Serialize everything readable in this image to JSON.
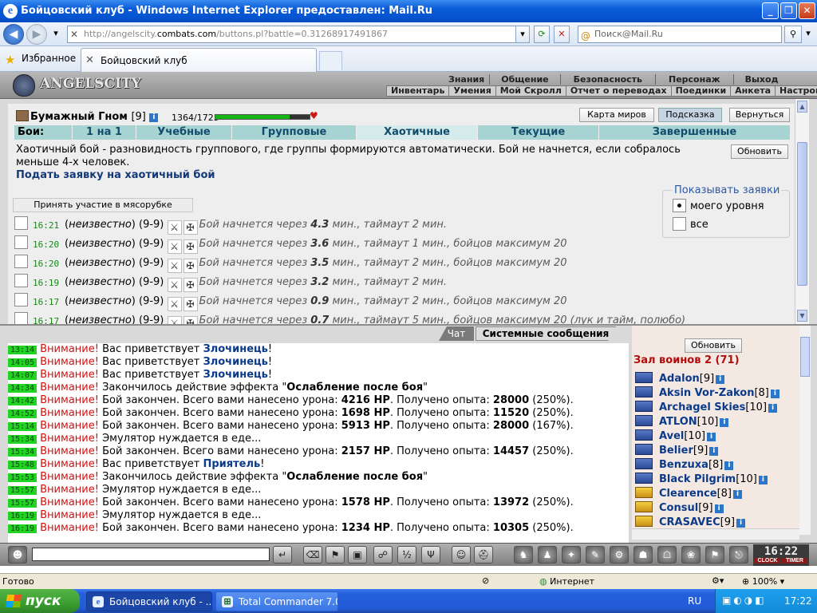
{
  "window": {
    "title": "Бойцовский клуб - Windows Internet Explorer предоставлен: Mail.Ru"
  },
  "browser": {
    "url_prefix": "http://angelscity.",
    "url_domain": "combats.com",
    "url_rest": "/buttons.pl?battle=0.31268917491867",
    "search_placeholder": "Поиск@Mail.Ru",
    "favorites_label": "Избранное",
    "tab_title": "Бойцовский клуб"
  },
  "game": {
    "logo_text": "ANGELSCITY",
    "menu_top": [
      "Знания",
      "Общение",
      "Безопасность",
      "Персонаж",
      "Выход"
    ],
    "menu_bottom": [
      "Инвентарь",
      "Умения",
      "Мой Скролл",
      "Отчет о переводах",
      "Поединки",
      "Анкета",
      "Настройки"
    ],
    "player": {
      "name": "Бумажный Гном",
      "level": "[9]",
      "hp": "1364/1725",
      "hp_fraction": 0.79
    },
    "top_buttons": [
      "Карта миров",
      "Подсказка",
      "Вернуться"
    ],
    "tabs_label": "Бои:",
    "tabs": [
      "1 на 1",
      "Учебные",
      "Групповые",
      "Хаотичные",
      "Текущие",
      "Завершенные"
    ],
    "selected_tab": "Хаотичные",
    "description": "Хаотичный бой - разновидность группового, где группы формируются автоматически. Бой не начнется, если собралось меньше 4-х человек.",
    "refresh_label": "Обновить",
    "apply_link": "Подать заявку на хаотичный бой",
    "join_button": "Принять участие в мясорубке",
    "show_filter": {
      "caption": "Показывать заявки",
      "options": [
        "моего уровня",
        "все"
      ],
      "selected": "моего уровня"
    },
    "battles": [
      {
        "time": "16:21",
        "who": "неизвестно",
        "range": "(9-9)",
        "msg_pre": "Бой начнется через ",
        "minutes": "4.3",
        "msg_post": " мин., таймаут 2 мин."
      },
      {
        "time": "16:20",
        "who": "неизвестно",
        "range": "(9-9)",
        "msg_pre": "Бой начнется через ",
        "minutes": "3.6",
        "msg_post": " мин., таймаут 1 мин., бойцов максимум 20"
      },
      {
        "time": "16:20",
        "who": "неизвестно",
        "range": "(9-9)",
        "msg_pre": "Бой начнется через ",
        "minutes": "3.5",
        "msg_post": " мин., таймаут 2 мин., бойцов максимум 20"
      },
      {
        "time": "16:19",
        "who": "неизвестно",
        "range": "(9-9)",
        "msg_pre": "Бой начнется через ",
        "minutes": "3.2",
        "msg_post": " мин., таймаут 2 мин."
      },
      {
        "time": "16:17",
        "who": "неизвестно",
        "range": "(9-9)",
        "msg_pre": "Бой начнется через ",
        "minutes": "0.9",
        "msg_post": " мин., таймаут 2 мин., бойцов максимум 20"
      },
      {
        "time": "16:17",
        "who": "неизвестно",
        "range": "(9-9)",
        "msg_pre": "Бой начнется через ",
        "minutes": "0.7",
        "msg_post": " мин., таймаут 5 мин., бойцов максимум 20 (лук и тайм, полюбо)"
      }
    ],
    "chat_tabs": [
      "Чат",
      "Системные сообщения"
    ],
    "chat": [
      {
        "ts": "13:14",
        "w": "Внимание!",
        "parts": [
          [
            "Вас приветствует ",
            ""
          ],
          [
            "Злочинець",
            "nm"
          ],
          [
            "!",
            ""
          ]
        ]
      },
      {
        "ts": "14:05",
        "w": "Внимание!",
        "parts": [
          [
            "Вас приветствует ",
            ""
          ],
          [
            "Злочинець",
            "nm"
          ],
          [
            "!",
            ""
          ]
        ]
      },
      {
        "ts": "14:07",
        "w": "Внимание!",
        "parts": [
          [
            "Вас приветствует ",
            ""
          ],
          [
            "Злочинець",
            "nm"
          ],
          [
            "!",
            ""
          ]
        ]
      },
      {
        "ts": "14:34",
        "w": "Внимание!",
        "parts": [
          [
            "Закончилось действие эффекта \"",
            ""
          ],
          [
            "Ослабление после боя",
            "b"
          ],
          [
            "\"",
            ""
          ]
        ]
      },
      {
        "ts": "14:42",
        "w": "Внимание!",
        "parts": [
          [
            "Бой закончен. Всего вами нанесено урона: ",
            ""
          ],
          [
            "4216 HP",
            "b"
          ],
          [
            ". Получено опыта: ",
            ""
          ],
          [
            "28000",
            "b"
          ],
          [
            " (250%).",
            ""
          ]
        ]
      },
      {
        "ts": "14:52",
        "w": "Внимание!",
        "parts": [
          [
            "Бой закончен. Всего вами нанесено урона: ",
            ""
          ],
          [
            "1698 HP",
            "b"
          ],
          [
            ". Получено опыта: ",
            ""
          ],
          [
            "11520",
            "b"
          ],
          [
            " (250%).",
            ""
          ]
        ]
      },
      {
        "ts": "15:14",
        "w": "Внимание!",
        "parts": [
          [
            "Бой закончен. Всего вами нанесено урона: ",
            ""
          ],
          [
            "5913 HP",
            "b"
          ],
          [
            ". Получено опыта: ",
            ""
          ],
          [
            "28000",
            "b"
          ],
          [
            " (167%).",
            ""
          ]
        ]
      },
      {
        "ts": "15:34",
        "w": "Внимание!",
        "parts": [
          [
            "Эмулятор нуждается в еде...",
            ""
          ]
        ]
      },
      {
        "ts": "15:34",
        "w": "Внимание!",
        "parts": [
          [
            "Бой закончен. Всего вами нанесено урона: ",
            ""
          ],
          [
            "2157 HP",
            "b"
          ],
          [
            ". Получено опыта: ",
            ""
          ],
          [
            "14457",
            "b"
          ],
          [
            " (250%).",
            ""
          ]
        ]
      },
      {
        "ts": "15:48",
        "w": "Внимание!",
        "parts": [
          [
            "Вас приветствует ",
            ""
          ],
          [
            "Приятель",
            "nm"
          ],
          [
            "!",
            ""
          ]
        ]
      },
      {
        "ts": "15:53",
        "w": "Внимание!",
        "parts": [
          [
            "Закончилось действие эффекта \"",
            ""
          ],
          [
            "Ослабление после боя",
            "b"
          ],
          [
            "\"",
            ""
          ]
        ]
      },
      {
        "ts": "15:57",
        "w": "Внимание!",
        "parts": [
          [
            "Эмулятор нуждается в еде...",
            ""
          ]
        ]
      },
      {
        "ts": "15:57",
        "w": "Внимание!",
        "parts": [
          [
            "Бой закончен. Всего вами нанесено урона: ",
            ""
          ],
          [
            "1578 HP",
            "b"
          ],
          [
            ". Получено опыта: ",
            ""
          ],
          [
            "13972",
            "b"
          ],
          [
            " (250%).",
            ""
          ]
        ]
      },
      {
        "ts": "16:19",
        "w": "Внимание!",
        "parts": [
          [
            "Эмулятор нуждается в еде...",
            ""
          ]
        ]
      },
      {
        "ts": "16:19",
        "w": "Внимание!",
        "parts": [
          [
            "Бой закончен. Всего вами нанесено урона: ",
            ""
          ],
          [
            "1234 HP",
            "b"
          ],
          [
            ". Получено опыта: ",
            ""
          ],
          [
            "10305",
            "b"
          ],
          [
            " (250%).",
            ""
          ]
        ]
      }
    ],
    "hall": {
      "title": "Зал воинов 2 (71)",
      "refresh": "Обновить",
      "users": [
        {
          "name": "Adalon",
          "level": "[9]"
        },
        {
          "name": "Aksin Vor-Zakon",
          "level": "[8]"
        },
        {
          "name": "Archagel Skies",
          "level": "[10]"
        },
        {
          "name": "ATLON",
          "level": "[10]"
        },
        {
          "name": "Avel",
          "level": "[10]"
        },
        {
          "name": "Belier",
          "level": "[9]"
        },
        {
          "name": "Benzuxa",
          "level": "[8]"
        },
        {
          "name": "Black Pilgrim",
          "level": "[10]"
        },
        {
          "name": "Clearence",
          "level": "[8]"
        },
        {
          "name": "Consul",
          "level": "[9]"
        },
        {
          "name": "CRASAVEC",
          "level": "[9]"
        }
      ]
    },
    "clock": {
      "time": "16:22",
      "label_left": "CLOCK",
      "label_right": "TIMER"
    }
  },
  "statusbar": {
    "text": "Готово",
    "zone": "Интернет",
    "zoom": "100%"
  },
  "taskbar": {
    "start": "пуск",
    "tasks": [
      "Бойцовский клуб - ...",
      "Total Commander 7.0..."
    ],
    "lang": "RU",
    "time": "17:22"
  }
}
